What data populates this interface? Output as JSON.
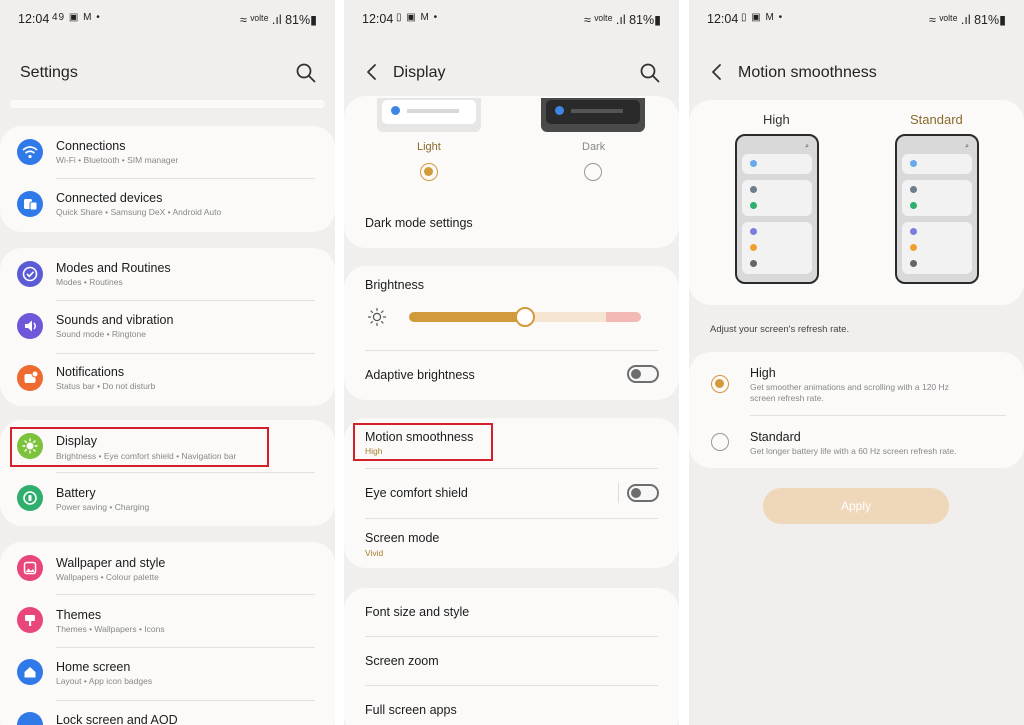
{
  "status": {
    "s1": {
      "time": "12:04",
      "icons": "49 ▣ M •",
      "right": "≈ ᵛᵒˡᵗᵉ .ıl 81%▮"
    },
    "s2": {
      "time": "12:04",
      "icons": "▯ ▣ M •",
      "right": "≈ ᵛᵒˡᵗᵉ .ıl 81%▮"
    },
    "s3": {
      "time": "12:04",
      "icons": "▯ ▣ M •",
      "right": "≈ ᵛᵒˡᵗᵉ .ıl 81%▮"
    }
  },
  "settings": {
    "title": "Settings",
    "items": [
      {
        "title": "Connections",
        "sub": "Wi-Fi  •  Bluetooth  •  SIM manager",
        "icon": "wifi-icon",
        "color": "#2f79e8"
      },
      {
        "title": "Connected devices",
        "sub": "Quick Share  •  Samsung DeX  •  Android Auto",
        "icon": "devices-icon",
        "color": "#2f79e8"
      },
      {
        "title": "Modes and Routines",
        "sub": "Modes  •  Routines",
        "icon": "check-icon",
        "color": "#5b5bd6"
      },
      {
        "title": "Sounds and vibration",
        "sub": "Sound mode  •  Ringtone",
        "icon": "speaker-icon",
        "color": "#6f57d9"
      },
      {
        "title": "Notifications",
        "sub": "Status bar  •  Do not disturb",
        "icon": "bell-icon",
        "color": "#ee6a2e"
      },
      {
        "title": "Display",
        "sub": "Brightness  •  Eye comfort shield  •  Navigation bar",
        "icon": "sun-icon",
        "color": "#7cc23c"
      },
      {
        "title": "Battery",
        "sub": "Power saving  •  Charging",
        "icon": "battery-icon",
        "color": "#2fae6e"
      },
      {
        "title": "Wallpaper and style",
        "sub": "Wallpapers  •  Colour palette",
        "icon": "image-icon",
        "color": "#e9467a"
      },
      {
        "title": "Themes",
        "sub": "Themes  •  Wallpapers  •  Icons",
        "icon": "theme-icon",
        "color": "#e9467a"
      },
      {
        "title": "Home screen",
        "sub": "Layout  •  App icon badges",
        "icon": "home-icon",
        "color": "#2f79e8"
      },
      {
        "title": "Lock screen and AOD",
        "sub": "",
        "icon": "lock-icon",
        "color": "#2f79e8"
      }
    ]
  },
  "display": {
    "title": "Display",
    "light_label": "Light",
    "dark_label": "Dark",
    "dark_mode_settings": "Dark mode settings",
    "brightness": "Brightness",
    "brightness_level": 0.5,
    "adaptive_brightness": "Adaptive brightness",
    "motion_smoothness": "Motion smoothness",
    "motion_value": "High",
    "eye_comfort": "Eye comfort shield",
    "screen_mode": "Screen mode",
    "screen_mode_value": "Vivid",
    "font_size": "Font size and style",
    "screen_zoom": "Screen zoom",
    "full_screen_apps": "Full screen apps"
  },
  "motion": {
    "title": "Motion smoothness",
    "high_label": "High",
    "standard_label": "Standard",
    "hint": "Adjust your screen's refresh rate.",
    "opt_high_title": "High",
    "opt_high_sub": "Get smoother animations and scrolling with a 120 Hz screen refresh rate.",
    "opt_std_title": "Standard",
    "opt_std_sub": "Get longer battery life with a 60 Hz screen refresh rate.",
    "apply": "Apply"
  },
  "colors": {
    "accent": "#d39a3c",
    "highlight": "#d4202a",
    "slider": "#d39a3c"
  }
}
